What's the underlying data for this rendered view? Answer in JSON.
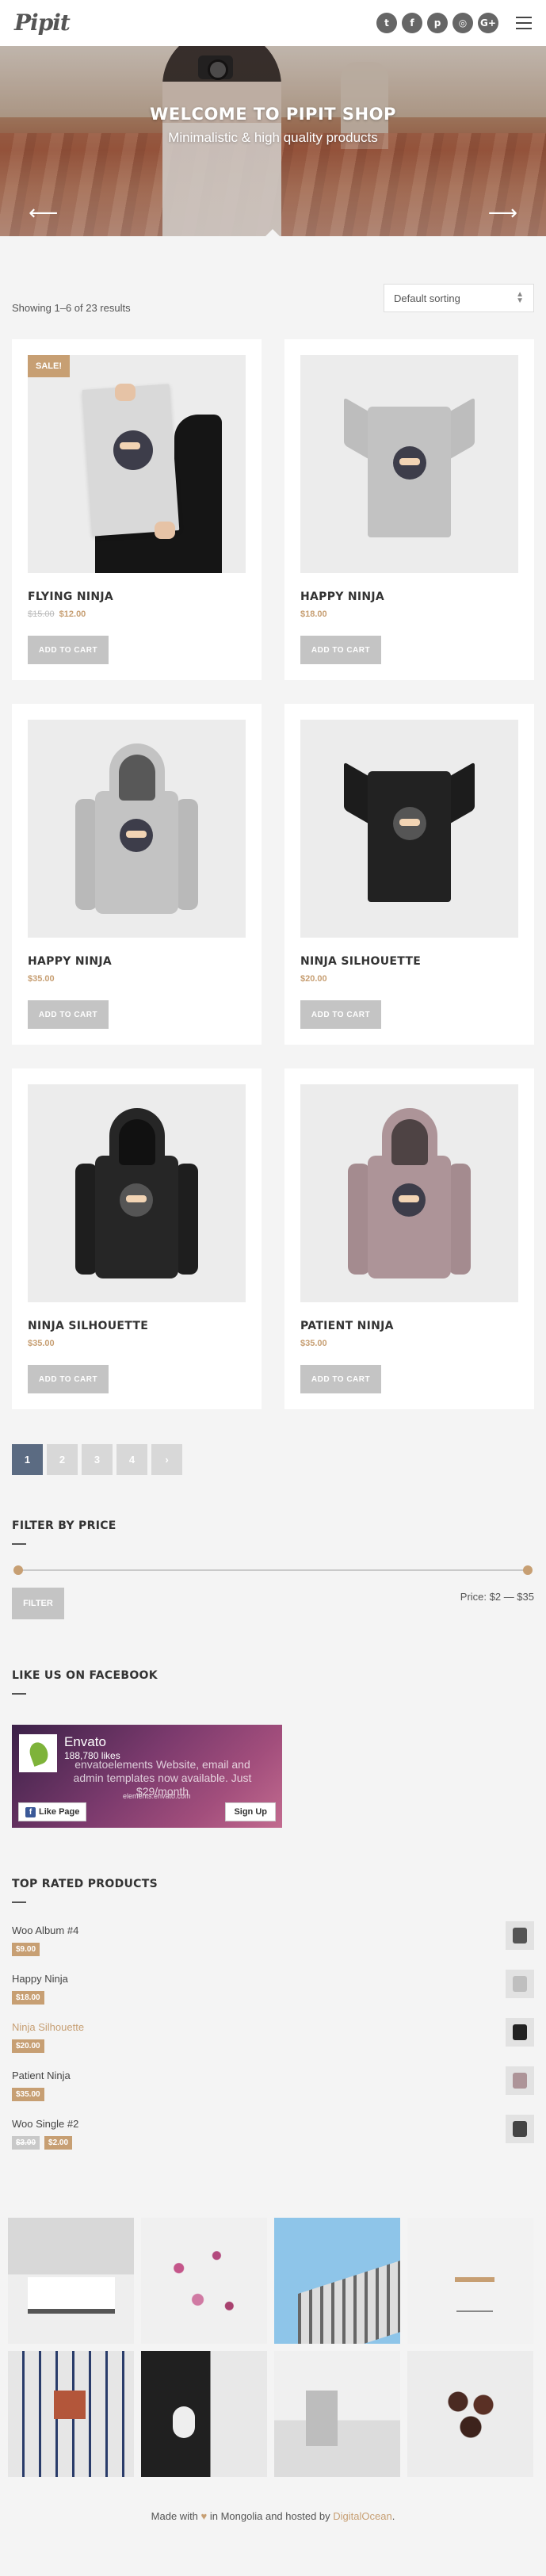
{
  "header": {
    "logo": "Pipit",
    "social": [
      {
        "icon": "twitter-icon",
        "glyph": "t"
      },
      {
        "icon": "facebook-icon",
        "glyph": "f"
      },
      {
        "icon": "pinterest-icon",
        "glyph": "p"
      },
      {
        "icon": "instagram-icon",
        "glyph": "◎"
      },
      {
        "icon": "google-plus-icon",
        "glyph": "G+"
      }
    ],
    "menu_icon": "hamburger-menu-icon"
  },
  "hero": {
    "title": "WELCOME TO PIPIT SHOP",
    "subtitle": "Minimalistic & high quality products",
    "prev_arrow": "⟵",
    "next_arrow": "⟶"
  },
  "shop": {
    "result_count": "Showing 1–6 of 23 results",
    "sorting_value": "Default sorting",
    "products": [
      {
        "name": "FLYING NINJA",
        "price_old": "$15.00",
        "price": "$12.00",
        "sale_badge": "SALE!",
        "button": "ADD TO CART"
      },
      {
        "name": "HAPPY NINJA",
        "price": "$18.00",
        "button": "ADD TO CART"
      },
      {
        "name": "HAPPY NINJA",
        "price": "$35.00",
        "button": "ADD TO CART"
      },
      {
        "name": "NINJA SILHOUETTE",
        "price": "$20.00",
        "button": "ADD TO CART"
      },
      {
        "name": "NINJA SILHOUETTE",
        "price": "$35.00",
        "button": "ADD TO CART"
      },
      {
        "name": "PATIENT NINJA",
        "price": "$35.00",
        "button": "ADD TO CART"
      }
    ],
    "pagination": [
      "1",
      "2",
      "3",
      "4",
      "›"
    ],
    "current_page": "1"
  },
  "widgets": {
    "price_filter": {
      "title": "FILTER BY PRICE",
      "button": "FILTER",
      "label": "Price: $2 — $35",
      "min": 2,
      "max": 35
    },
    "facebook": {
      "title": "LIKE US ON FACEBOOK",
      "page_name": "Envato",
      "likes": "188,780 likes",
      "promo": "envatoelements Website, email and admin templates now available. Just $29/month",
      "url": "elements.envato.com",
      "like_button": "Like Page",
      "signup_button": "Sign Up"
    },
    "top_rated": {
      "title": "TOP RATED PRODUCTS",
      "items": [
        {
          "name": "Woo Album #4",
          "price": "$9.00"
        },
        {
          "name": "Happy Ninja",
          "price": "$18.00"
        },
        {
          "name": "Ninja Silhouette",
          "price": "$20.00"
        },
        {
          "name": "Patient Ninja",
          "price": "$35.00"
        },
        {
          "name": "Woo Single #2",
          "price_old": "$3.00",
          "price": "$2.00"
        }
      ]
    }
  },
  "footer": {
    "text_before": "Made with",
    "heart": "♥",
    "text_middle": "in Mongolia and hosted by",
    "link": "DigitalOcean",
    "text_after": "."
  },
  "colors": {
    "accent": "#c79f73",
    "pagination_active": "#5b6b82",
    "button_gray": "#c4c4c4",
    "background": "#f4f4f4"
  }
}
